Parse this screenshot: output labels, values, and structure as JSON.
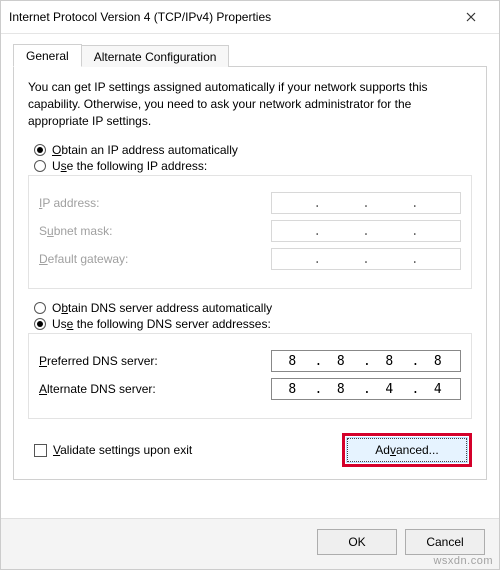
{
  "window": {
    "title": "Internet Protocol Version 4 (TCP/IPv4) Properties"
  },
  "tabs": {
    "general": "General",
    "alternate": "Alternate Configuration",
    "active": "general"
  },
  "description": "You can get IP settings assigned automatically if your network supports this capability. Otherwise, you need to ask your network administrator for the appropriate IP settings.",
  "ip": {
    "auto_label_pre": "O",
    "auto_label_rest": "btain an IP address automatically",
    "use_label_pre": "Use the following IP address:",
    "use_mnemonic": "s",
    "selected": "auto",
    "ip_label_pre": "I",
    "ip_label_rest": "P address:",
    "subnet_label_pre": "S",
    "subnet_label_rest": "ubnet mask:",
    "gateway_label_pre": "D",
    "gateway_label_rest": "efault gateway:"
  },
  "dns": {
    "auto_label": "Obtain DNS server address automatically",
    "auto_mnemonic": "b",
    "use_label": "Use the following DNS server addresses:",
    "use_mnemonic": "e",
    "selected": "use",
    "preferred_label_pre": "P",
    "preferred_label_rest": "referred DNS server:",
    "alternate_label_pre": "A",
    "alternate_label_rest": "lternate DNS server:",
    "preferred": {
      "o1": "8",
      "o2": "8",
      "o3": "8",
      "o4": "8"
    },
    "alternate": {
      "o1": "8",
      "o2": "8",
      "o3": "4",
      "o4": "4"
    }
  },
  "validate": {
    "label_pre": "V",
    "label_rest": "alidate settings upon exit",
    "checked": false
  },
  "advanced_label": "Advanced...",
  "advanced_mnemonic": "v",
  "footer": {
    "ok": "OK",
    "cancel": "Cancel"
  },
  "watermark": "wsxdn.com"
}
